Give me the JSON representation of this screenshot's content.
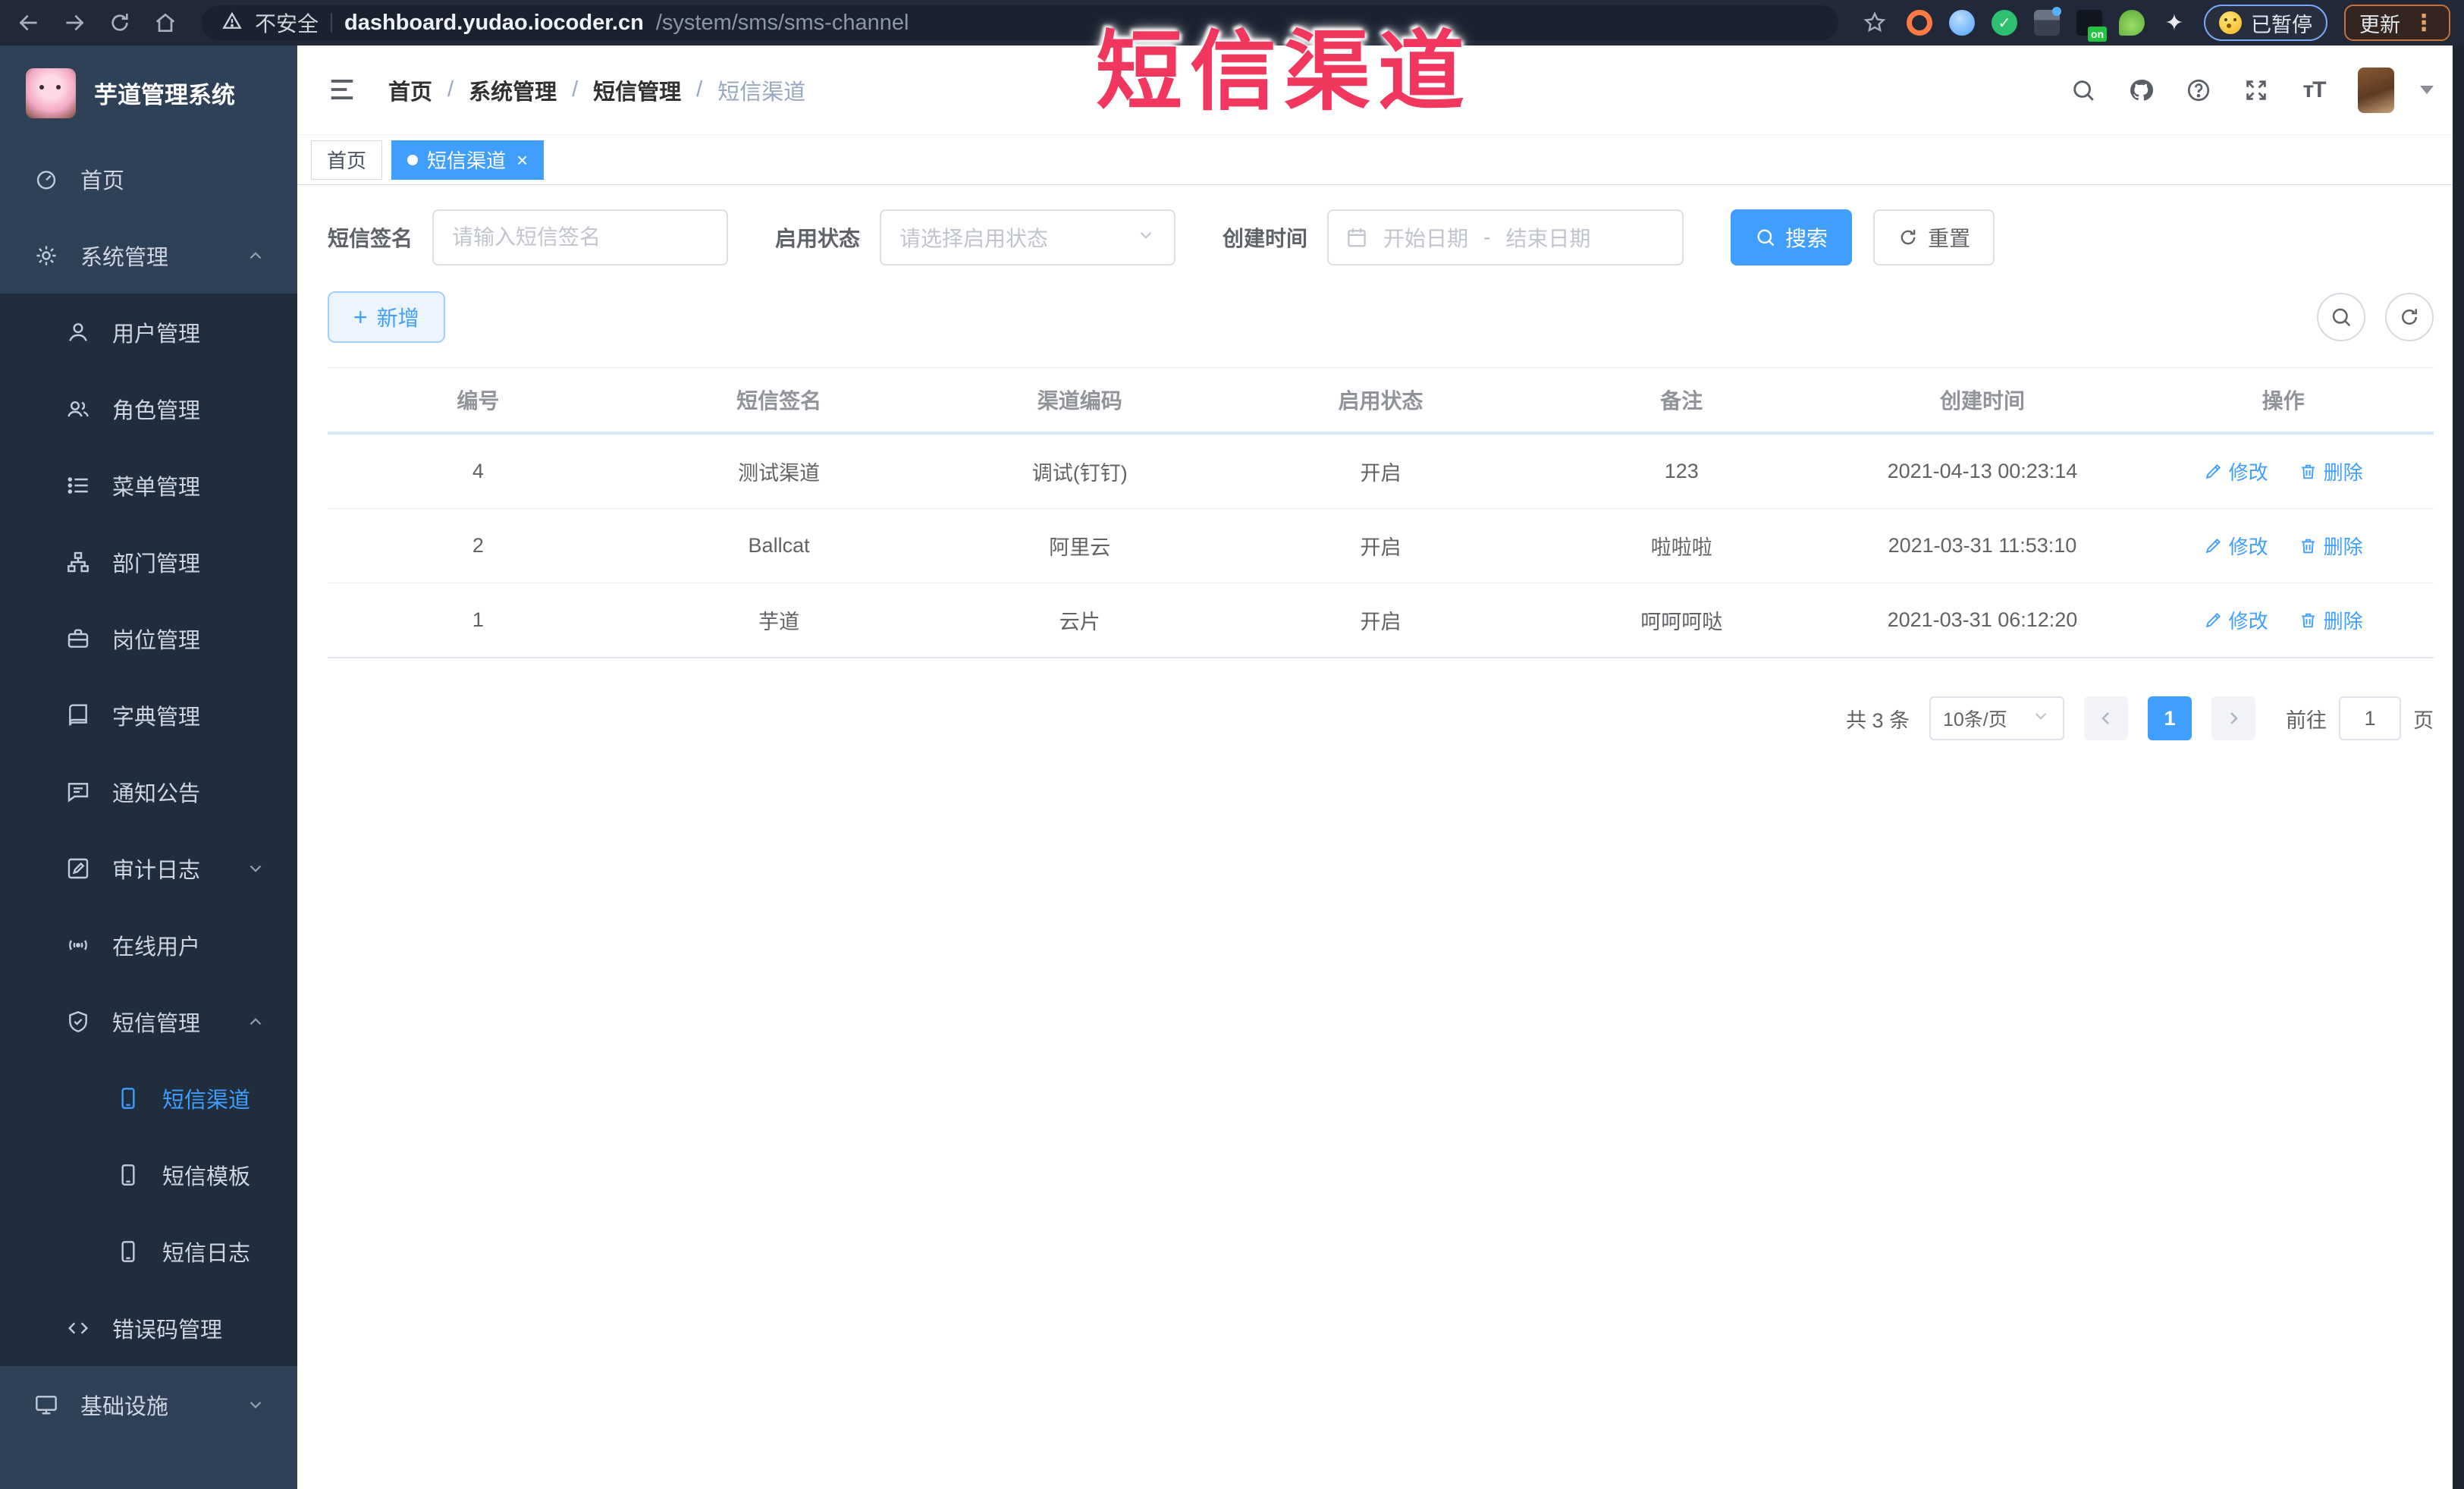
{
  "browser": {
    "security_label": "不安全",
    "url_host": "dashboard.yudao.iocoder.cn",
    "url_path": "/system/sms/sms-channel",
    "paused_label": "已暂停",
    "update_label": "更新",
    "extension_badge": "on"
  },
  "icons": {
    "close_glyph": "×",
    "check_glyph": "✓",
    "plus_glyph": "+",
    "kebab_glyph": "⋮",
    "meeple_glyph": "✦",
    "font_size_glyph": "тT"
  },
  "annotation": {
    "text": "短信渠道",
    "color": "#f2375f"
  },
  "sidebar": {
    "title": "芋道管理系统",
    "items": [
      {
        "label": "首页"
      },
      {
        "label": "系统管理"
      },
      {
        "label": "用户管理"
      },
      {
        "label": "角色管理"
      },
      {
        "label": "菜单管理"
      },
      {
        "label": "部门管理"
      },
      {
        "label": "岗位管理"
      },
      {
        "label": "字典管理"
      },
      {
        "label": "通知公告"
      },
      {
        "label": "审计日志"
      },
      {
        "label": "在线用户"
      },
      {
        "label": "短信管理"
      },
      {
        "label": "短信渠道"
      },
      {
        "label": "短信模板"
      },
      {
        "label": "短信日志"
      },
      {
        "label": "错误码管理"
      },
      {
        "label": "基础设施"
      }
    ]
  },
  "breadcrumb": {
    "separator": "/",
    "items": [
      "首页",
      "系统管理",
      "短信管理",
      "短信渠道"
    ]
  },
  "tabs": [
    {
      "label": "首页"
    },
    {
      "label": "短信渠道"
    }
  ],
  "filters": {
    "signature_label": "短信签名",
    "signature_placeholder": "请输入短信签名",
    "status_label": "启用状态",
    "status_placeholder": "请选择启用状态",
    "time_label": "创建时间",
    "start_placeholder": "开始日期",
    "range_separator": "-",
    "end_placeholder": "结束日期",
    "search_label": "搜索",
    "reset_label": "重置"
  },
  "toolbar": {
    "add_label": "新增"
  },
  "table": {
    "headers": [
      "编号",
      "短信签名",
      "渠道编码",
      "启用状态",
      "备注",
      "创建时间",
      "操作"
    ],
    "edit_label": "修改",
    "delete_label": "删除",
    "rows": [
      {
        "id": "4",
        "signature": "测试渠道",
        "code": "调试(钉钉)",
        "status": "开启",
        "remark": "123",
        "created": "2021-04-13 00:23:14"
      },
      {
        "id": "2",
        "signature": "Ballcat",
        "code": "阿里云",
        "status": "开启",
        "remark": "啦啦啦",
        "created": "2021-03-31 11:53:10"
      },
      {
        "id": "1",
        "signature": "芋道",
        "code": "云片",
        "status": "开启",
        "remark": "呵呵呵哒",
        "created": "2021-03-31 06:12:20"
      }
    ]
  },
  "pagination": {
    "total_label": "共 3 条",
    "page_size_label": "10条/页",
    "current_page": "1",
    "goto_label": "前往",
    "goto_value": "1",
    "page_unit_label": "页"
  },
  "colors": {
    "accent": "#409eff",
    "sidebar_bg": "#1f2d3d",
    "sidebar_light_bg": "#2f4156",
    "annotation": "#f2375f"
  }
}
